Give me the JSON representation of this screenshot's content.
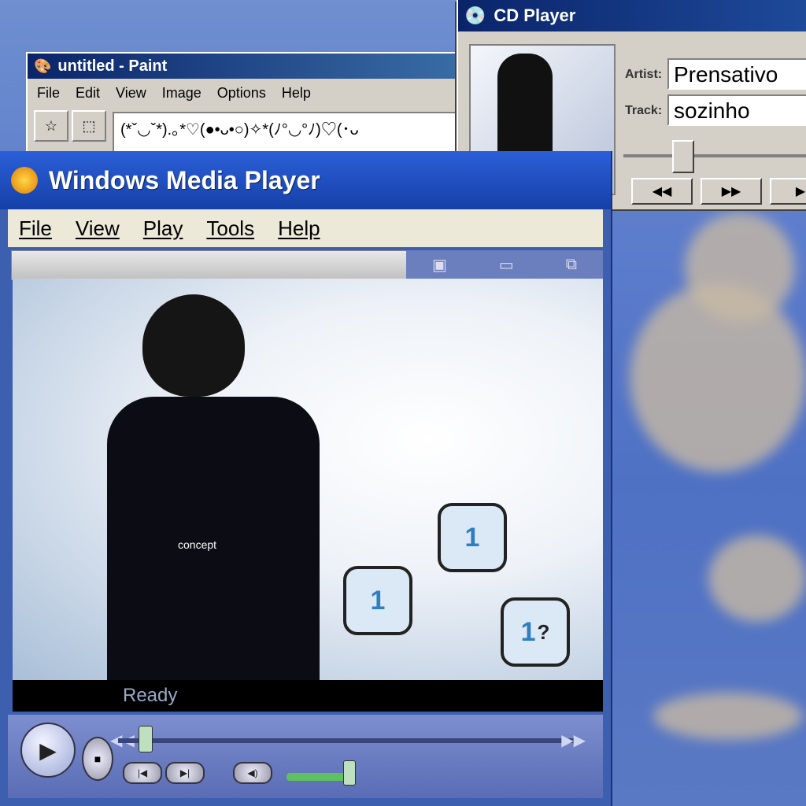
{
  "paint": {
    "title": "untitled - Paint",
    "menu": [
      "File",
      "Edit",
      "View",
      "Image",
      "Options",
      "Help"
    ],
    "canvas_text": "(*ˇ◡ˇ*).｡*♡(●•ᴗ•○)✧*(ﾉ°◡°ﾉ)♡(･ᴗ"
  },
  "cd": {
    "title": "CD Player",
    "artist_label": "Artist:",
    "artist_value": "Prensativo",
    "track_label": "Track:",
    "track_value": "sozinho",
    "buttons": [
      "◀◀",
      "▶▶",
      "▶"
    ]
  },
  "wmp": {
    "title": "Windows Media Player",
    "menu": [
      "File",
      "View",
      "Play",
      "Tools",
      "Help"
    ],
    "status": "Ready",
    "shirt_text": "concept",
    "hand_digit": "1",
    "hand_question": "?",
    "controls": {
      "play": "▶",
      "stop": "■",
      "prev": "|◀",
      "next": "▶|",
      "mute": "◀)",
      "rewind": "◀◀",
      "forward": "▶▶"
    }
  }
}
